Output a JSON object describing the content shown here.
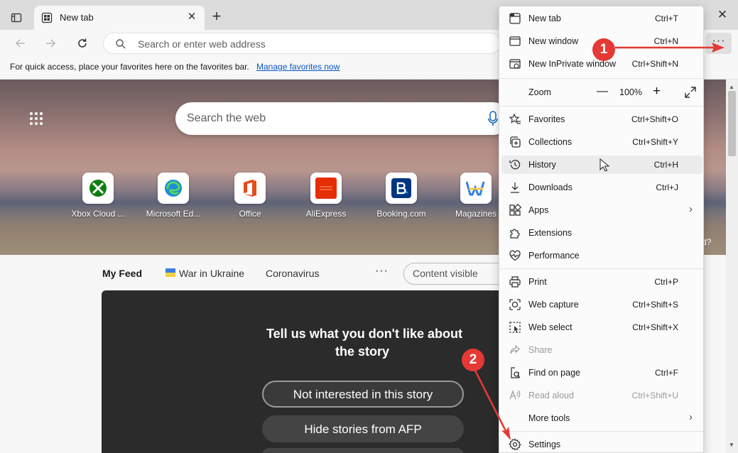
{
  "browser": {
    "tab_title": "New tab",
    "tab_close": "✕",
    "new_tab_button": "+",
    "window_close": "✕",
    "more_button": "···"
  },
  "toolbar": {
    "address_placeholder": "Search or enter web address"
  },
  "favorites_bar": {
    "message": "For quick access, place your favorites here on the favorites bar.",
    "link": "Manage favorites now"
  },
  "newtab": {
    "search_placeholder": "Search the web",
    "quick_links": [
      {
        "label": "Xbox Cloud ...",
        "icon": "xbox-icon",
        "color": "#107c10"
      },
      {
        "label": "Microsoft Ed...",
        "icon": "edge-icon",
        "color": "#1b8fd6"
      },
      {
        "label": "Office",
        "icon": "office-icon",
        "color": "#e64a19"
      },
      {
        "label": "AliExpress",
        "icon": "aliexpress-icon",
        "color": "#e62e04"
      },
      {
        "label": "Booking.com",
        "icon": "booking-icon",
        "color": "#003580"
      },
      {
        "label": "Magazines",
        "icon": "magazines-icon",
        "color": "#2f80ed"
      }
    ],
    "hero_partial_text": "d?",
    "feed": {
      "my_feed": "My Feed",
      "ukraine": "War in Ukraine",
      "coronavirus": "Coronavirus",
      "more": "···",
      "content_visible": "Content visible"
    },
    "card": {
      "question_line1": "Tell us what you don't like about",
      "question_line2": "the story",
      "option1": "Not interested in this story",
      "option2": "Hide stories from AFP"
    }
  },
  "menu": {
    "items": [
      {
        "label": "New tab",
        "shortcut": "Ctrl+T",
        "icon": "new-tab-icon"
      },
      {
        "label": "New window",
        "shortcut": "Ctrl+N",
        "icon": "new-window-icon"
      },
      {
        "label": "New InPrivate window",
        "shortcut": "Ctrl+Shift+N",
        "icon": "inprivate-icon"
      },
      {
        "label": "Favorites",
        "shortcut": "Ctrl+Shift+O",
        "icon": "favorites-icon"
      },
      {
        "label": "Collections",
        "shortcut": "Ctrl+Shift+Y",
        "icon": "collections-icon"
      },
      {
        "label": "History",
        "shortcut": "Ctrl+H",
        "icon": "history-icon"
      },
      {
        "label": "Downloads",
        "shortcut": "Ctrl+J",
        "icon": "downloads-icon"
      },
      {
        "label": "Apps",
        "shortcut": "",
        "icon": "apps-icon"
      },
      {
        "label": "Extensions",
        "shortcut": "",
        "icon": "extensions-icon"
      },
      {
        "label": "Performance",
        "shortcut": "",
        "icon": "performance-icon"
      },
      {
        "label": "Print",
        "shortcut": "Ctrl+P",
        "icon": "print-icon"
      },
      {
        "label": "Web capture",
        "shortcut": "Ctrl+Shift+S",
        "icon": "web-capture-icon"
      },
      {
        "label": "Web select",
        "shortcut": "Ctrl+Shift+X",
        "icon": "web-select-icon"
      },
      {
        "label": "Share",
        "shortcut": "",
        "icon": "share-icon"
      },
      {
        "label": "Find on page",
        "shortcut": "Ctrl+F",
        "icon": "find-icon"
      },
      {
        "label": "Read aloud",
        "shortcut": "Ctrl+Shift+U",
        "icon": "read-aloud-icon"
      },
      {
        "label": "More tools",
        "shortcut": "",
        "icon": "more-tools-icon"
      },
      {
        "label": "Settings",
        "shortcut": "",
        "icon": "settings-icon"
      }
    ],
    "zoom": {
      "label": "Zoom",
      "minus": "—",
      "value": "100%",
      "plus": "+"
    }
  },
  "annotations": {
    "badge1": "1",
    "badge2": "2",
    "color": "#e53935"
  },
  "colors": {
    "accent": "#0a58ca",
    "menu_hover": "#ececec"
  }
}
